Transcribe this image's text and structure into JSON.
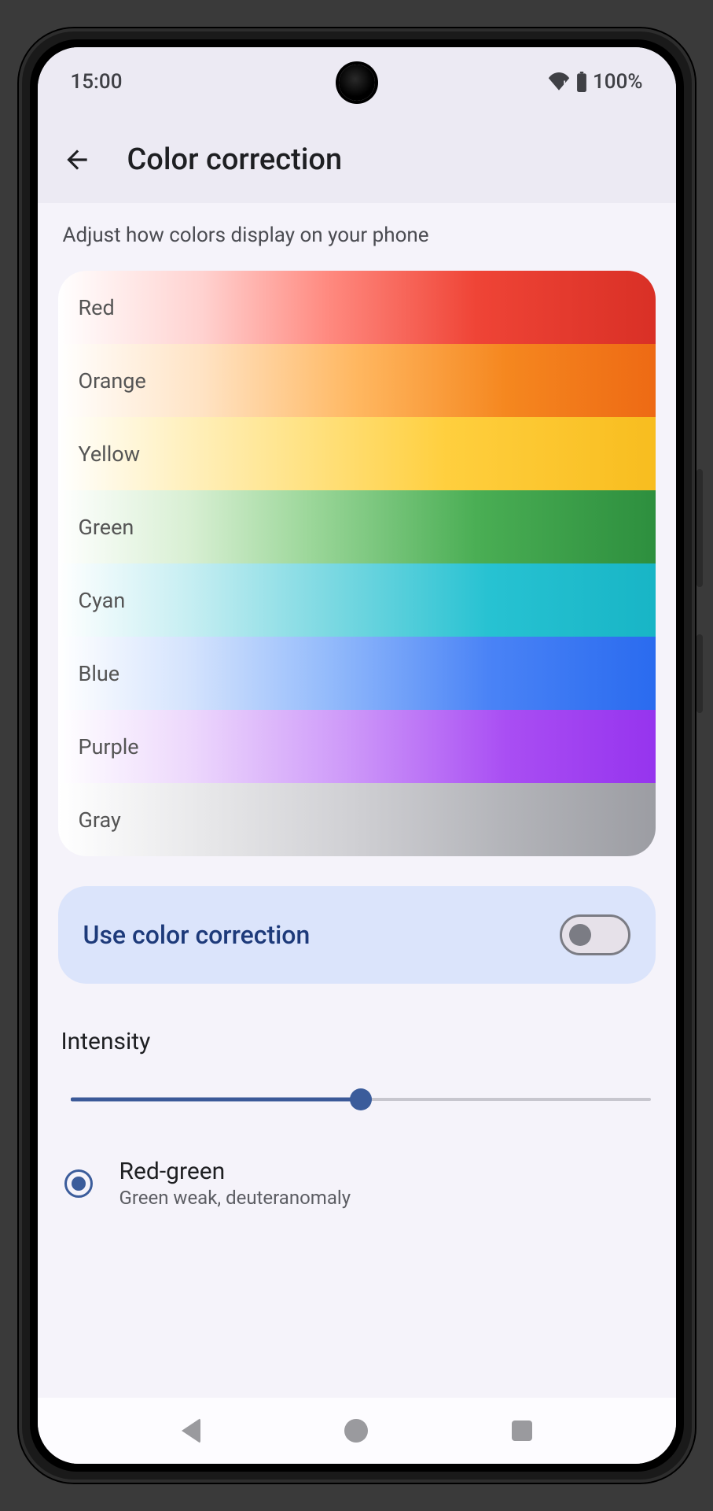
{
  "status": {
    "time": "15:00",
    "battery_pct": "100%"
  },
  "header": {
    "title": "Color correction"
  },
  "description": "Adjust how colors display on your phone",
  "swatches": [
    {
      "label": "Red"
    },
    {
      "label": "Orange"
    },
    {
      "label": "Yellow"
    },
    {
      "label": "Green"
    },
    {
      "label": "Cyan"
    },
    {
      "label": "Blue"
    },
    {
      "label": "Purple"
    },
    {
      "label": "Gray"
    }
  ],
  "toggle": {
    "label": "Use color correction",
    "enabled": false
  },
  "intensity": {
    "title": "Intensity",
    "value_pct": 50
  },
  "option": {
    "title": "Red-green",
    "subtitle": "Green weak, deuteranomaly",
    "selected": true
  },
  "colors": {
    "accent": "#3b5c9b",
    "toggle_card_bg": "#dbe4fb"
  }
}
